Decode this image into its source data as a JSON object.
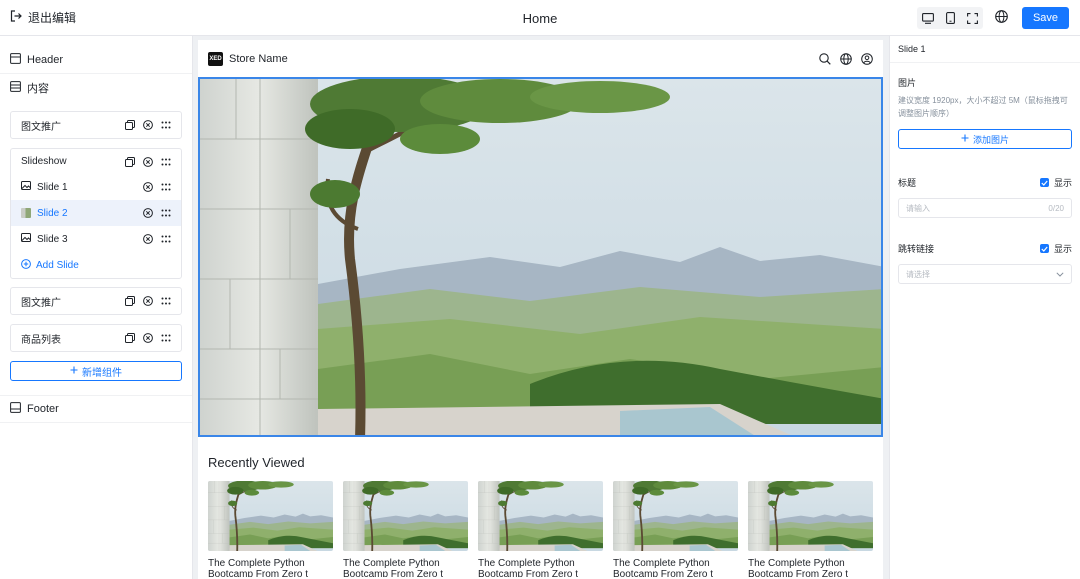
{
  "topbar": {
    "exit_label": "退出编辑",
    "page_title": "Home",
    "save_label": "Save"
  },
  "sidebar": {
    "header_label": "Header",
    "content_label": "内容",
    "footer_label": "Footer",
    "components": [
      {
        "label": "图文推广"
      },
      {
        "label": "Slideshow",
        "slides": [
          "Slide 1",
          "Slide 2",
          "Slide 3"
        ],
        "add_slide_label": "Add Slide"
      },
      {
        "label": "图文推广"
      },
      {
        "label": "商品列表"
      }
    ],
    "add_component_label": "新增组件"
  },
  "canvas": {
    "logo_text": "XED",
    "store_name": "Store Name",
    "recently_viewed_title": "Recently Viewed",
    "products": [
      {
        "name": "The Complete Python",
        "sub": "Bootcamp From Zero t"
      },
      {
        "name": "The Complete Python",
        "sub": "Bootcamp From Zero t"
      },
      {
        "name": "The Complete Python",
        "sub": "Bootcamp From Zero t"
      },
      {
        "name": "The Complete Python",
        "sub": "Bootcamp From Zero t"
      },
      {
        "name": "The Complete Python",
        "sub": "Bootcamp From Zero t"
      }
    ]
  },
  "panel": {
    "title": "Slide 1",
    "image_label": "图片",
    "image_hint": "建议宽度 1920px，大小不超过 5M（鼠标拖拽可调整图片顺序）",
    "add_image_label": "添加图片",
    "heading_label": "标题",
    "show_label": "显示",
    "heading_placeholder": "请输入",
    "heading_counter": "0/20",
    "link_label": "跳转链接",
    "link_placeholder": "请选择"
  },
  "colors": {
    "accent": "#1677ff",
    "selection": "#3a86e8",
    "active_row": "#edf2fb"
  }
}
